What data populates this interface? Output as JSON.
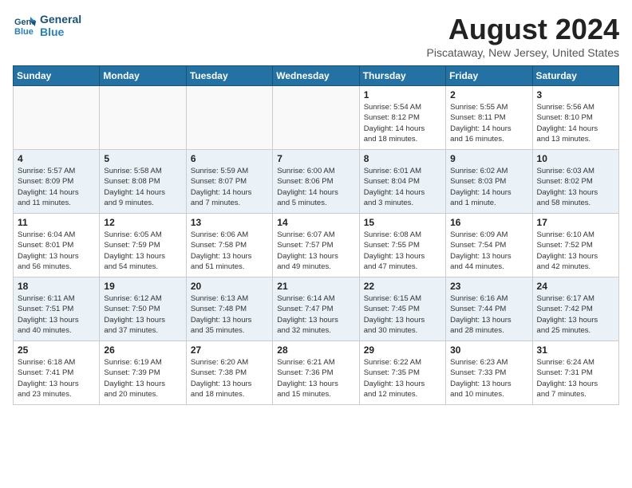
{
  "header": {
    "logo_line1": "General",
    "logo_line2": "Blue",
    "month_year": "August 2024",
    "location": "Piscataway, New Jersey, United States"
  },
  "days_of_week": [
    "Sunday",
    "Monday",
    "Tuesday",
    "Wednesday",
    "Thursday",
    "Friday",
    "Saturday"
  ],
  "weeks": [
    [
      {
        "day": "",
        "info": ""
      },
      {
        "day": "",
        "info": ""
      },
      {
        "day": "",
        "info": ""
      },
      {
        "day": "",
        "info": ""
      },
      {
        "day": "1",
        "info": "Sunrise: 5:54 AM\nSunset: 8:12 PM\nDaylight: 14 hours\nand 18 minutes."
      },
      {
        "day": "2",
        "info": "Sunrise: 5:55 AM\nSunset: 8:11 PM\nDaylight: 14 hours\nand 16 minutes."
      },
      {
        "day": "3",
        "info": "Sunrise: 5:56 AM\nSunset: 8:10 PM\nDaylight: 14 hours\nand 13 minutes."
      }
    ],
    [
      {
        "day": "4",
        "info": "Sunrise: 5:57 AM\nSunset: 8:09 PM\nDaylight: 14 hours\nand 11 minutes."
      },
      {
        "day": "5",
        "info": "Sunrise: 5:58 AM\nSunset: 8:08 PM\nDaylight: 14 hours\nand 9 minutes."
      },
      {
        "day": "6",
        "info": "Sunrise: 5:59 AM\nSunset: 8:07 PM\nDaylight: 14 hours\nand 7 minutes."
      },
      {
        "day": "7",
        "info": "Sunrise: 6:00 AM\nSunset: 8:06 PM\nDaylight: 14 hours\nand 5 minutes."
      },
      {
        "day": "8",
        "info": "Sunrise: 6:01 AM\nSunset: 8:04 PM\nDaylight: 14 hours\nand 3 minutes."
      },
      {
        "day": "9",
        "info": "Sunrise: 6:02 AM\nSunset: 8:03 PM\nDaylight: 14 hours\nand 1 minute."
      },
      {
        "day": "10",
        "info": "Sunrise: 6:03 AM\nSunset: 8:02 PM\nDaylight: 13 hours\nand 58 minutes."
      }
    ],
    [
      {
        "day": "11",
        "info": "Sunrise: 6:04 AM\nSunset: 8:01 PM\nDaylight: 13 hours\nand 56 minutes."
      },
      {
        "day": "12",
        "info": "Sunrise: 6:05 AM\nSunset: 7:59 PM\nDaylight: 13 hours\nand 54 minutes."
      },
      {
        "day": "13",
        "info": "Sunrise: 6:06 AM\nSunset: 7:58 PM\nDaylight: 13 hours\nand 51 minutes."
      },
      {
        "day": "14",
        "info": "Sunrise: 6:07 AM\nSunset: 7:57 PM\nDaylight: 13 hours\nand 49 minutes."
      },
      {
        "day": "15",
        "info": "Sunrise: 6:08 AM\nSunset: 7:55 PM\nDaylight: 13 hours\nand 47 minutes."
      },
      {
        "day": "16",
        "info": "Sunrise: 6:09 AM\nSunset: 7:54 PM\nDaylight: 13 hours\nand 44 minutes."
      },
      {
        "day": "17",
        "info": "Sunrise: 6:10 AM\nSunset: 7:52 PM\nDaylight: 13 hours\nand 42 minutes."
      }
    ],
    [
      {
        "day": "18",
        "info": "Sunrise: 6:11 AM\nSunset: 7:51 PM\nDaylight: 13 hours\nand 40 minutes."
      },
      {
        "day": "19",
        "info": "Sunrise: 6:12 AM\nSunset: 7:50 PM\nDaylight: 13 hours\nand 37 minutes."
      },
      {
        "day": "20",
        "info": "Sunrise: 6:13 AM\nSunset: 7:48 PM\nDaylight: 13 hours\nand 35 minutes."
      },
      {
        "day": "21",
        "info": "Sunrise: 6:14 AM\nSunset: 7:47 PM\nDaylight: 13 hours\nand 32 minutes."
      },
      {
        "day": "22",
        "info": "Sunrise: 6:15 AM\nSunset: 7:45 PM\nDaylight: 13 hours\nand 30 minutes."
      },
      {
        "day": "23",
        "info": "Sunrise: 6:16 AM\nSunset: 7:44 PM\nDaylight: 13 hours\nand 28 minutes."
      },
      {
        "day": "24",
        "info": "Sunrise: 6:17 AM\nSunset: 7:42 PM\nDaylight: 13 hours\nand 25 minutes."
      }
    ],
    [
      {
        "day": "25",
        "info": "Sunrise: 6:18 AM\nSunset: 7:41 PM\nDaylight: 13 hours\nand 23 minutes."
      },
      {
        "day": "26",
        "info": "Sunrise: 6:19 AM\nSunset: 7:39 PM\nDaylight: 13 hours\nand 20 minutes."
      },
      {
        "day": "27",
        "info": "Sunrise: 6:20 AM\nSunset: 7:38 PM\nDaylight: 13 hours\nand 18 minutes."
      },
      {
        "day": "28",
        "info": "Sunrise: 6:21 AM\nSunset: 7:36 PM\nDaylight: 13 hours\nand 15 minutes."
      },
      {
        "day": "29",
        "info": "Sunrise: 6:22 AM\nSunset: 7:35 PM\nDaylight: 13 hours\nand 12 minutes."
      },
      {
        "day": "30",
        "info": "Sunrise: 6:23 AM\nSunset: 7:33 PM\nDaylight: 13 hours\nand 10 minutes."
      },
      {
        "day": "31",
        "info": "Sunrise: 6:24 AM\nSunset: 7:31 PM\nDaylight: 13 hours\nand 7 minutes."
      }
    ]
  ]
}
